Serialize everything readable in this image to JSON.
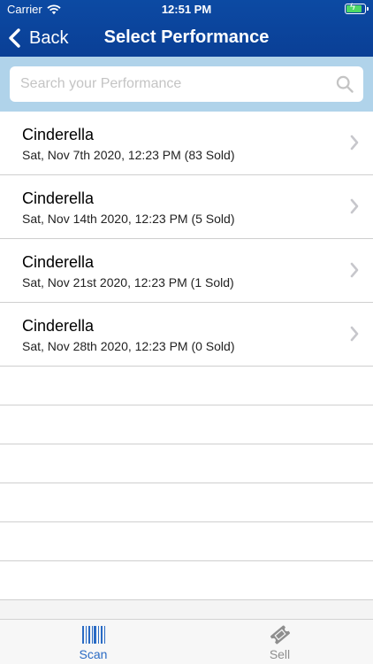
{
  "status_bar": {
    "carrier": "Carrier",
    "time": "12:51 PM"
  },
  "nav": {
    "back_label": "Back",
    "title": "Select Performance"
  },
  "search": {
    "placeholder": "Search your Performance",
    "value": ""
  },
  "performances": [
    {
      "title": "Cinderella",
      "subtitle": "Sat, Nov 7th 2020, 12:23 PM (83 Sold)"
    },
    {
      "title": "Cinderella",
      "subtitle": "Sat, Nov 14th 2020, 12:23 PM (5 Sold)"
    },
    {
      "title": "Cinderella",
      "subtitle": "Sat, Nov 21st 2020, 12:23 PM (1 Sold)"
    },
    {
      "title": "Cinderella",
      "subtitle": "Sat, Nov 28th 2020, 12:23 PM (0 Sold)"
    }
  ],
  "tabs": [
    {
      "label": "Scan",
      "icon": "barcode-icon",
      "active": true
    },
    {
      "label": "Sell",
      "icon": "ticket-icon",
      "active": false
    }
  ],
  "colors": {
    "nav_background": "#0c4aa3",
    "search_background": "#b0d3ea",
    "active_tab": "#2a6bc4",
    "inactive_tab": "#8e8e8e",
    "battery_charging": "#4cd964"
  }
}
